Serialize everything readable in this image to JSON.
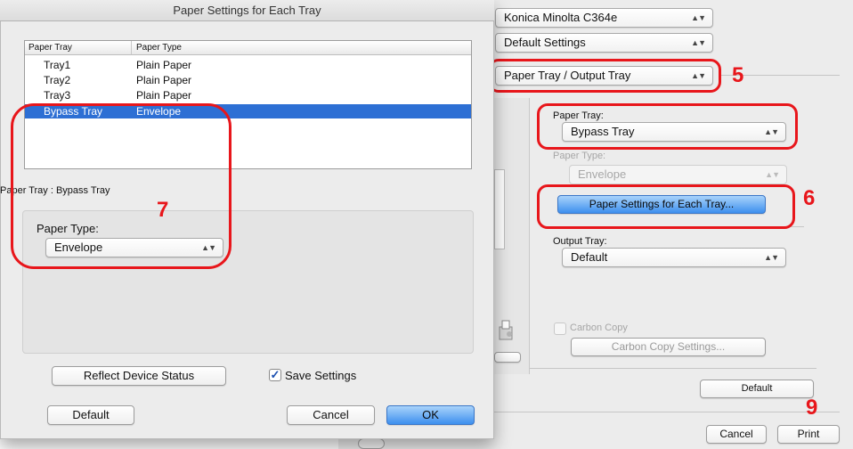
{
  "print_dialog": {
    "printer": "Konica Minolta C364e",
    "presets": "Default Settings",
    "panel": "Paper Tray / Output Tray",
    "paper_tray_label": "Paper Tray:",
    "paper_tray_value": "Bypass Tray",
    "paper_type_label": "Paper Type:",
    "paper_type_value": "Envelope",
    "paper_settings_button": "Paper Settings for Each Tray...",
    "output_tray_label": "Output Tray:",
    "output_tray_value": "Default",
    "carbon_copy_label": "Carbon Copy",
    "carbon_copy_settings_button": "Carbon Copy Settings...",
    "default_button": "Default",
    "cancel_button": "Cancel",
    "print_button": "Print"
  },
  "sheet": {
    "title": "Paper Settings for Each Tray",
    "columns": [
      "Paper Tray",
      "Paper Type"
    ],
    "rows": [
      {
        "tray": "Tray1",
        "type": "Plain Paper"
      },
      {
        "tray": "Tray2",
        "type": "Plain Paper"
      },
      {
        "tray": "Tray3",
        "type": "Plain Paper"
      },
      {
        "tray": "Bypass Tray",
        "type": "Envelope",
        "selected": true
      }
    ],
    "selected_caption": "Paper Tray : Bypass Tray",
    "paper_type_label": "Paper Type:",
    "paper_type_value": "Envelope",
    "reflect_button": "Reflect Device Status",
    "save_settings_label": "Save Settings",
    "save_settings_checked": true,
    "default_button": "Default",
    "cancel_button": "Cancel",
    "ok_button": "OK"
  },
  "callouts": [
    "5",
    "6",
    "7",
    "9"
  ],
  "colors": {
    "callout": "#e8161b",
    "selection": "#2d6fd4",
    "default_button": "#3d8fee"
  },
  "icons": [
    "popup-arrows-icon",
    "checkmark-icon",
    "printer-preview-icon"
  ]
}
